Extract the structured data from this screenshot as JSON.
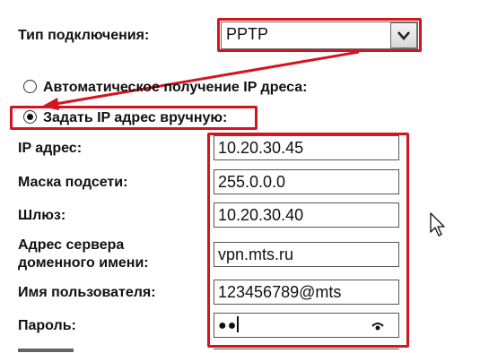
{
  "connection_type": {
    "label": "Тип подключения:",
    "value": "PPTP"
  },
  "ip_mode": {
    "auto_label": "Автоматическое получение IP дреса:",
    "manual_label": "Задать IP адрес вручную:",
    "selected": "manual"
  },
  "fields": {
    "ip_label": "IP адрес:",
    "ip_value": "10.20.30.45",
    "mask_label": "Маска подсети:",
    "mask_value": "255.0.0.0",
    "gateway_label": "Шлюз:",
    "gateway_value": "10.20.30.40",
    "server_label_line1": "Адрес сервера",
    "server_label_line2": "доменного имени:",
    "server_value": "vpn.mts.ru",
    "user_label": "Имя пользователя:",
    "user_value": "123456789@mts",
    "password_label": "Пароль:",
    "password_value": "●●"
  },
  "colors": {
    "highlight": "#d4141e"
  },
  "icons": {
    "dropdown": "chevron-down-icon",
    "reveal": "eye-icon",
    "cursor": "mouse-pointer-icon"
  }
}
